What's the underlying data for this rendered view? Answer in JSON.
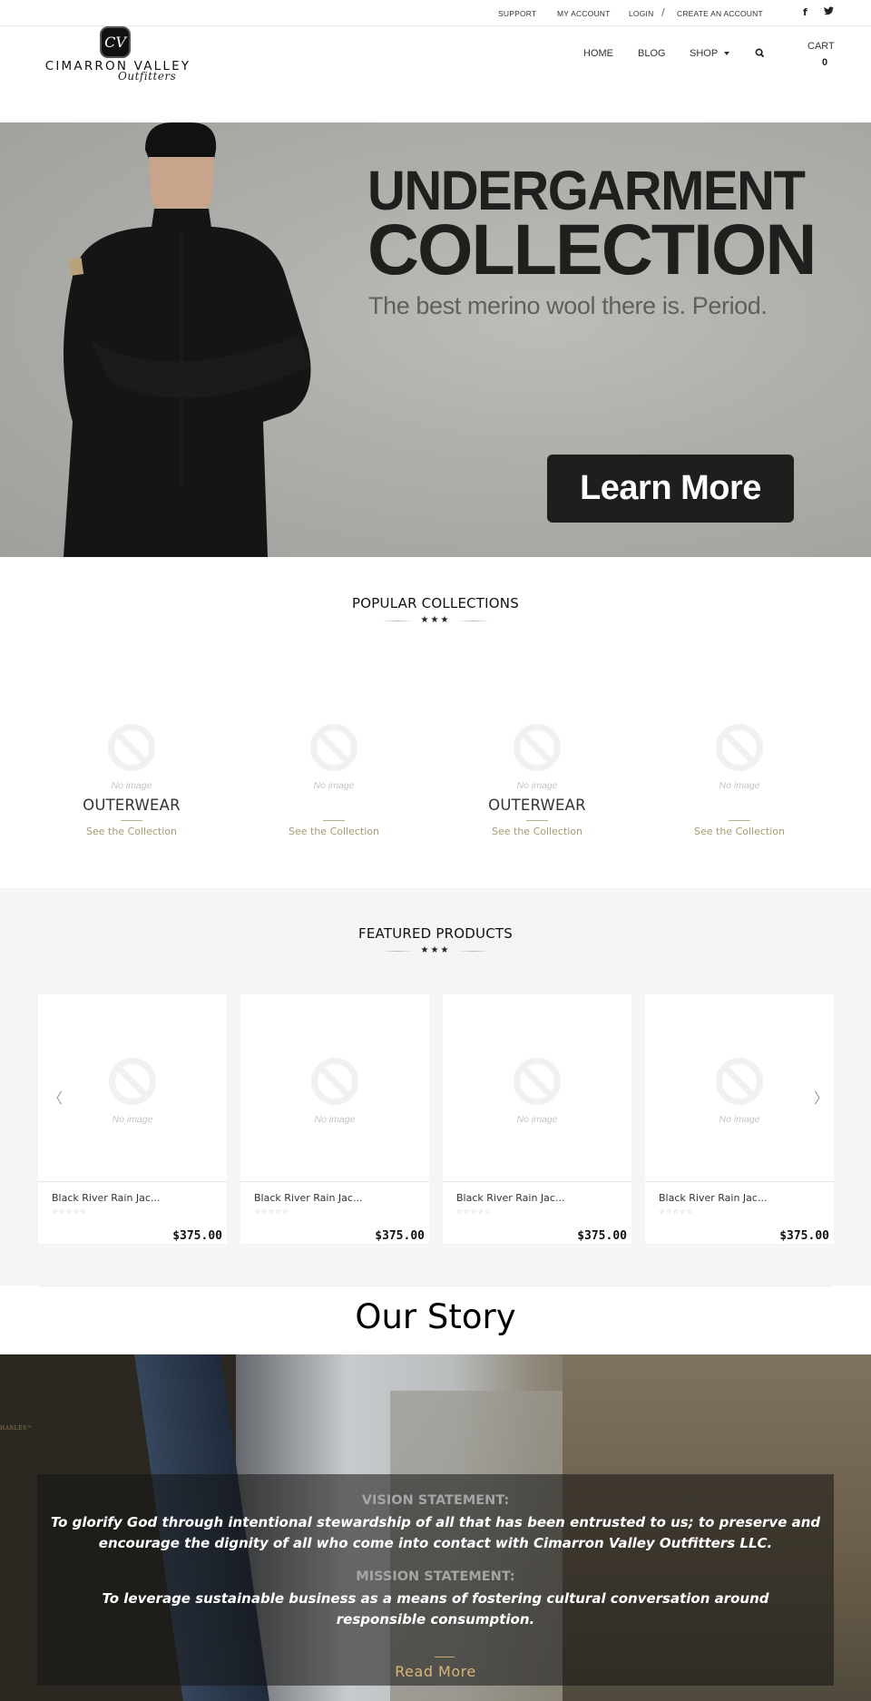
{
  "topbar": {
    "links": [
      "Support",
      "My Account",
      "Login",
      "Create an Account"
    ],
    "separator": "/",
    "social": [
      {
        "icon": "facebook-icon",
        "glyph": "f"
      },
      {
        "icon": "twitter-icon",
        "glyph": "🐦"
      }
    ]
  },
  "logo": {
    "badge": "CV",
    "name": "CIMARRON VALLEY",
    "script": "Outfitters"
  },
  "nav": {
    "items": [
      "Home",
      "Blog",
      "Shop"
    ],
    "search_icon": "search-icon",
    "cart_label": "CART",
    "cart_count": "0"
  },
  "hero": {
    "title_line1": "UNDERGARMENT",
    "title_line2": "COLLECTION",
    "subtitle": "The best merino wool there is. Period.",
    "button_label": "Learn More"
  },
  "popular": {
    "title": "POPULAR COLLECTIONS",
    "stars": "★★★",
    "no_image_text": "No image",
    "items": [
      {
        "name": "OUTERWEAR",
        "link": "See the Collection"
      },
      {
        "name": "",
        "link": "See the Collection"
      },
      {
        "name": "OUTERWEAR",
        "link": "See the Collection"
      },
      {
        "name": "",
        "link": "See the Collection"
      }
    ]
  },
  "featured": {
    "title": "FEATURED PRODUCTS",
    "stars": "★★★",
    "no_image_text": "No image",
    "prev_arrow": "〈",
    "next_arrow": "〉",
    "products": [
      {
        "name": "Black River Rain Jac...",
        "rating": "☆☆☆☆☆",
        "price": "$375.00"
      },
      {
        "name": "Black River Rain Jac...",
        "rating": "☆☆☆☆☆",
        "price": "$375.00"
      },
      {
        "name": "Black River Rain Jac...",
        "rating": "☆☆☆☆☆",
        "price": "$375.00"
      },
      {
        "name": "Black River Rain Jac...",
        "rating": "☆☆☆☆☆",
        "price": "$375.00"
      }
    ]
  },
  "story": {
    "title": "Our Story",
    "brand_tag": "HARLES™",
    "vision_heading": "VISION STATEMENT:",
    "vision_text": "To glorify God through intentional stewardship of all that has been entrusted to us; to preserve and encourage the dignity of all who come into contact with Cimarron Valley Outfitters LLC.",
    "mission_heading": "MISSION STATEMENT:",
    "mission_text": "To leverage sustainable business as a means of fostering cultural conversation around responsible consumption.",
    "read_more": "Read More"
  },
  "colors": {
    "accent_gold": "#a89a72",
    "read_more_gold": "#d8b678",
    "hero_button": "#1e1e1c",
    "featured_bg": "#f5f5f5"
  }
}
